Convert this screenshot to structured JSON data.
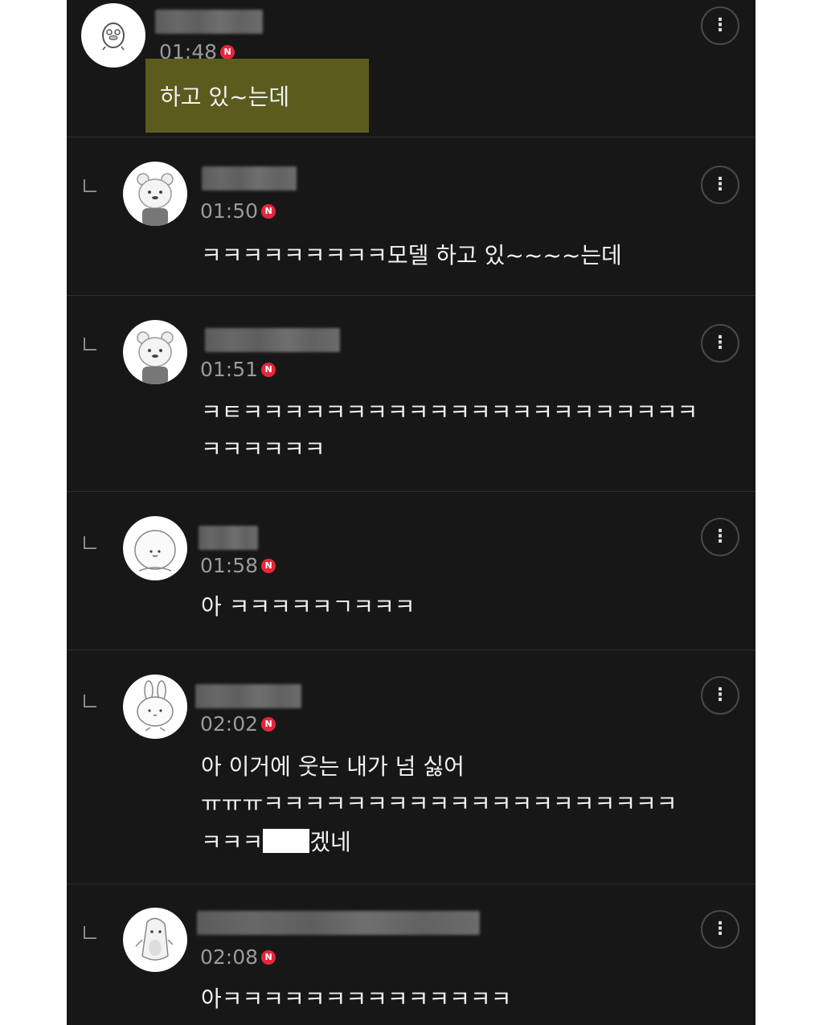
{
  "comments": [
    {
      "time": "01:48",
      "badge": "N",
      "text": "하고 있~는데",
      "avatar": "duck-avatar"
    },
    {
      "time": "01:50",
      "badge": "N",
      "text": "ㅋㅋㅋㅋㅋㅋㅋㅋㅋ모델 하고 있~~~~는데",
      "avatar": "bear-avatar"
    },
    {
      "time": "01:51",
      "badge": "N",
      "line1": "ㅋㅌㅋㅋㅋㅋㅋㅋㅋㅋㅋㅋㅋㅋㅋㅋㅋㅋㅋㅋㅋㅋㅋㅋ",
      "line2": "ㅋㅋㅋㅋㅋㅋ",
      "avatar": "bear-avatar"
    },
    {
      "time": "01:58",
      "badge": "N",
      "text": "아 ㅋㅋㅋㅋㅋㄱㅋㅋㅋ",
      "avatar": "round-face-avatar"
    },
    {
      "time": "02:02",
      "badge": "N",
      "line1": "아 이거에 웃는 내가 넘 싫어",
      "line2": "ㅠㅠㅠㅋㅋㅋㅋㅋㅋㅋㅋㅋㅋㅋㅋㅋㅋㅋㅋㅋㅋㅋㅋ",
      "line3_pre": "ㅋㅋㅋ",
      "line3_post": "겠네",
      "avatar": "bunny-avatar"
    },
    {
      "time": "02:08",
      "badge": "N",
      "text": "아ㅋㅋㅋㅋㅋㅋㅋㅋㅋㅋㅋㅋㅋㅋ",
      "avatar": "penguin-avatar"
    }
  ],
  "more_icon": "⋮",
  "colors": {
    "background": "#171717",
    "text": "#f2f2f2",
    "time": "#9a9a9a",
    "badge": "#e5263b",
    "highlight": "#5b5b1e"
  }
}
